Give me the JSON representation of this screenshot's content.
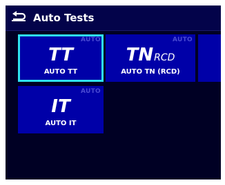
{
  "header": {
    "title": "Auto Tests",
    "icon": "back-arrow-icon"
  },
  "tiles": [
    {
      "tag": "AUTO",
      "symbol": "TT",
      "symbol_sub": "",
      "label": "AUTO TT",
      "selected": true
    },
    {
      "tag": "AUTO",
      "symbol": "TN",
      "symbol_sub": "RCD",
      "label": "AUTO TN (RCD)",
      "selected": false
    },
    {
      "tag": "AUTO",
      "symbol": "IT",
      "symbol_sub": "",
      "label": "AUTO IT",
      "selected": false
    }
  ],
  "colors": {
    "screen_bg": "#000024",
    "tile_bg": "#0000a8",
    "selection": "#2ee3f0",
    "auto_tag": "#4a4ad2"
  }
}
